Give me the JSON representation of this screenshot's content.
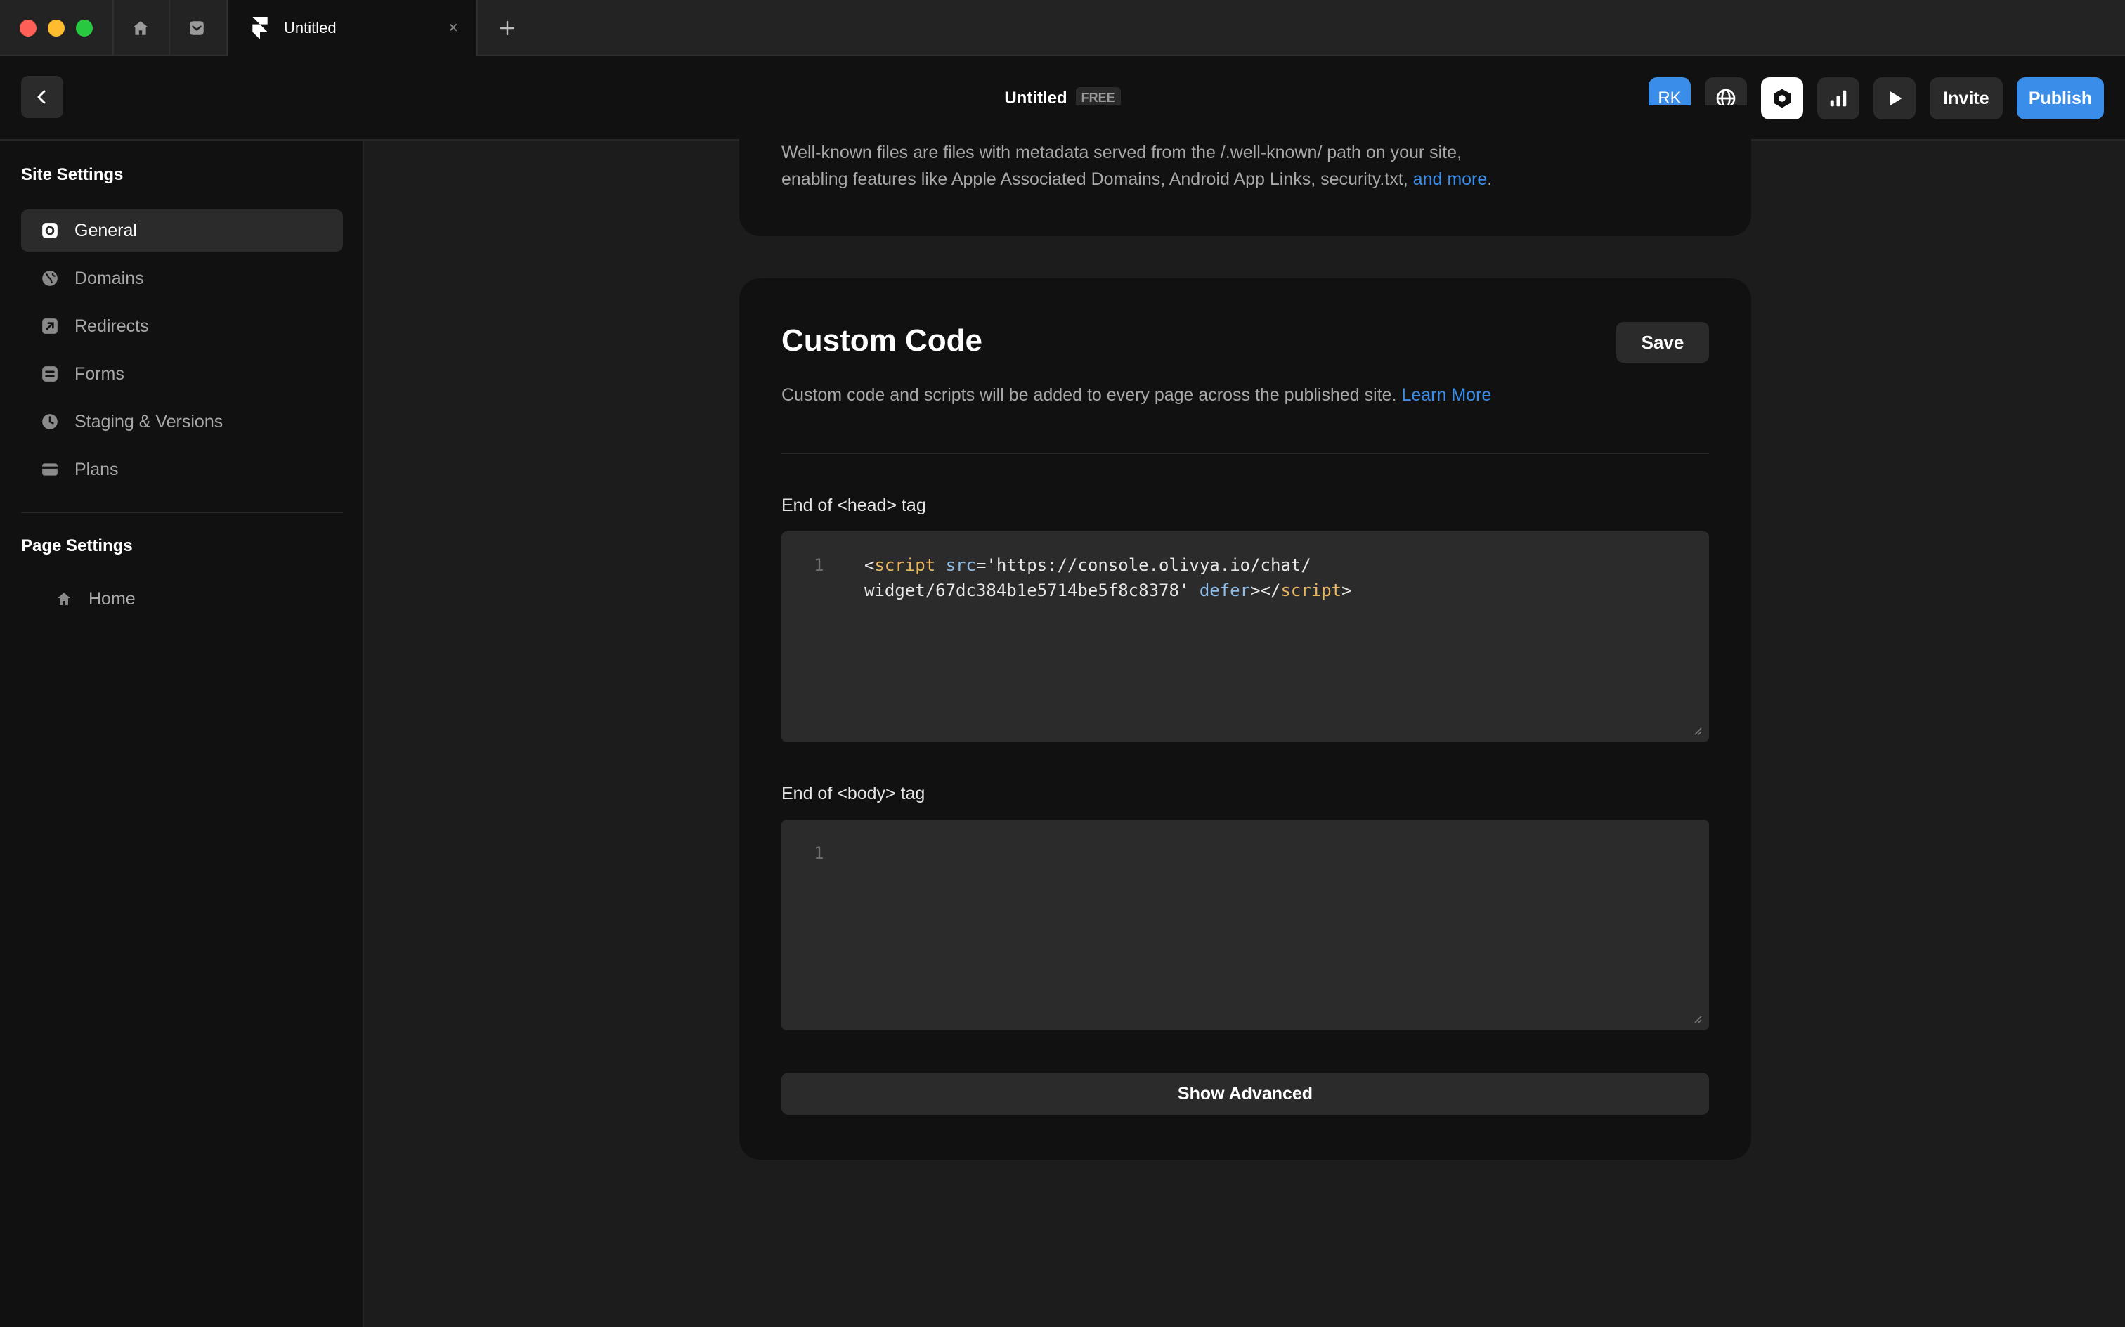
{
  "tabbar": {
    "active_tab_title": "Untitled",
    "close_glyph": "×",
    "home_icon": "home-icon",
    "inbox_icon": "inbox-icon",
    "new_tab_icon": "plus-icon"
  },
  "toolbar": {
    "project_title": "Untitled",
    "plan_badge": "FREE",
    "avatar_initials": "RK",
    "invite_label": "Invite",
    "publish_label": "Publish",
    "accent_color": "#3a8de8"
  },
  "sidebar": {
    "site_heading": "Site Settings",
    "items": [
      {
        "label": "General",
        "icon": "gear-icon",
        "active": true
      },
      {
        "label": "Domains",
        "icon": "globe-icon",
        "active": false
      },
      {
        "label": "Redirects",
        "icon": "redirect-arrow-icon",
        "active": false
      },
      {
        "label": "Forms",
        "icon": "form-icon",
        "active": false
      },
      {
        "label": "Staging & Versions",
        "icon": "clock-icon",
        "active": false
      },
      {
        "label": "Plans",
        "icon": "card-icon",
        "active": false
      }
    ],
    "page_heading": "Page Settings",
    "pages": [
      {
        "label": "Home",
        "icon": "home-icon"
      }
    ]
  },
  "well_known": {
    "text_line1": "Well-known files are files with metadata served from the /.well-known/ path on your site,",
    "text_line2": "enabling features like Apple Associated Domains, Android App Links, security.txt,",
    "link": "and more",
    "trailing": "."
  },
  "custom_code": {
    "title": "Custom Code",
    "save_label": "Save",
    "description": "Custom code and scripts will be added to every page across the published site.",
    "learn_more": "Learn More",
    "head_label": "End of <head> tag",
    "head_code": {
      "line_number": "1",
      "open_lt": "<",
      "tag": "script",
      "attr_src": "src",
      "eq_value": "='https://console.olivya.io/chat/\nwidget/67dc384b1e5714be5f8c8378' ",
      "attr_defer": "defer",
      "close_part": "></",
      "tag_close": "script",
      "end_gt": ">"
    },
    "body_label": "End of <body> tag",
    "body_code": {
      "line_number": "1",
      "content": ""
    },
    "advanced_label": "Show Advanced"
  }
}
